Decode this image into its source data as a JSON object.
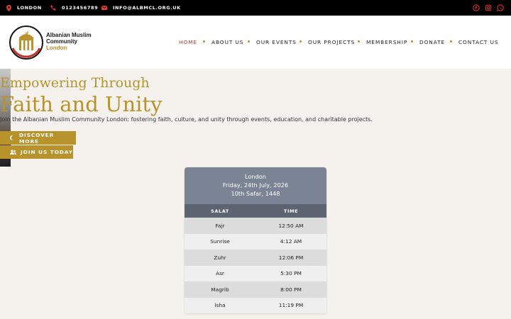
{
  "topbar": {
    "location": "LONDON",
    "phone": "0123456789",
    "email": "INFO@ALBMCL.ORG.UK",
    "icons": [
      "map-pin-icon",
      "phone-icon",
      "mail-icon",
      "facebook-icon",
      "instagram-icon",
      "whatsapp-icon"
    ],
    "icon_color": "#e53935"
  },
  "logo": {
    "line1": "Albanian Muslim",
    "line2": "Community",
    "line3": "London"
  },
  "nav": {
    "items": [
      "HOME",
      "ABOUT US",
      "OUR EVENTS",
      "OUR PROJECTS",
      "MEMBERSHIP",
      "DONATE",
      "CONTACT US"
    ],
    "active": "HOME"
  },
  "hero": {
    "title_line1": "Empowering Through",
    "title_line2": "Faith and Unity",
    "subtitle": "Join the Albanian Muslim Community London: fostering faith, culture, and unity through events, education, and charitable projects.",
    "discover_label": "DISCOVER MORE",
    "join_label": "JOIN US TODAY"
  },
  "prayer": {
    "city": "London",
    "gregorian_date": "Friday, 24th July, 2026",
    "hijri_date": "10th Safar, 1448",
    "col_salat": "SALAT",
    "col_time": "TIME",
    "rows": [
      {
        "name": "Fajr",
        "time": "12:50 AM"
      },
      {
        "name": "Sunrise",
        "time": "4:12 AM"
      },
      {
        "name": "Zuhr",
        "time": "12:06 PM"
      },
      {
        "name": "Asr",
        "time": "5:30 PM"
      },
      {
        "name": "Magrib",
        "time": "8:00 PM"
      },
      {
        "name": "Isha",
        "time": "11:19 PM"
      }
    ]
  },
  "colors": {
    "gold": "#b8922a",
    "active_nav": "#c3322b",
    "card_header": "#7a8494",
    "card_columns": "#5c6471",
    "background": "#f5f2ed"
  }
}
